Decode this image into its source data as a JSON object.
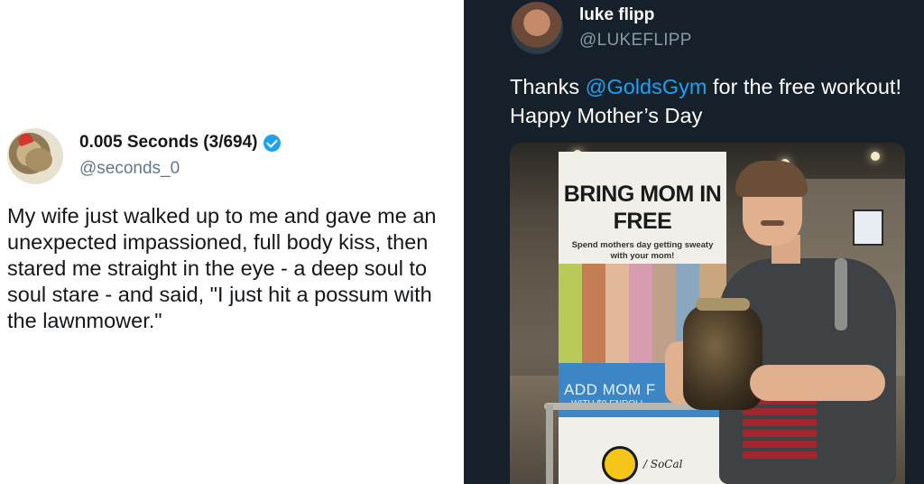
{
  "left_tweet": {
    "author_name": "0.005 Seconds (3/694)",
    "handle": "@seconds_0",
    "text": "My wife just walked up to me and gave me an unexpected impassioned, full body kiss, then stared me straight in the eye - a deep soul to soul stare -  and said, \"I just hit a possum with the lawnmower.\"",
    "verified": true,
    "verified_color": "#1da1f2"
  },
  "right_tweet": {
    "author_name": "luke flipp",
    "handle": "@LUKEFLIPP",
    "text_prefix": "Thanks ",
    "mention": "@GoldsGym",
    "text_suffix": " for the free workout! Happy Mother’s Day",
    "background": "#15202b",
    "mention_color": "#1da1f2",
    "photo": {
      "banner_headline": "BRING MOM IN FREE",
      "banner_sub": "Spend mothers day getting sweaty with your mom!",
      "banner_cta": "ADD MOM F",
      "banner_cta_sub": "WITH $0 ENROLL",
      "logo_text": "GOLD'S GYM",
      "region": "/ SoCal"
    }
  }
}
